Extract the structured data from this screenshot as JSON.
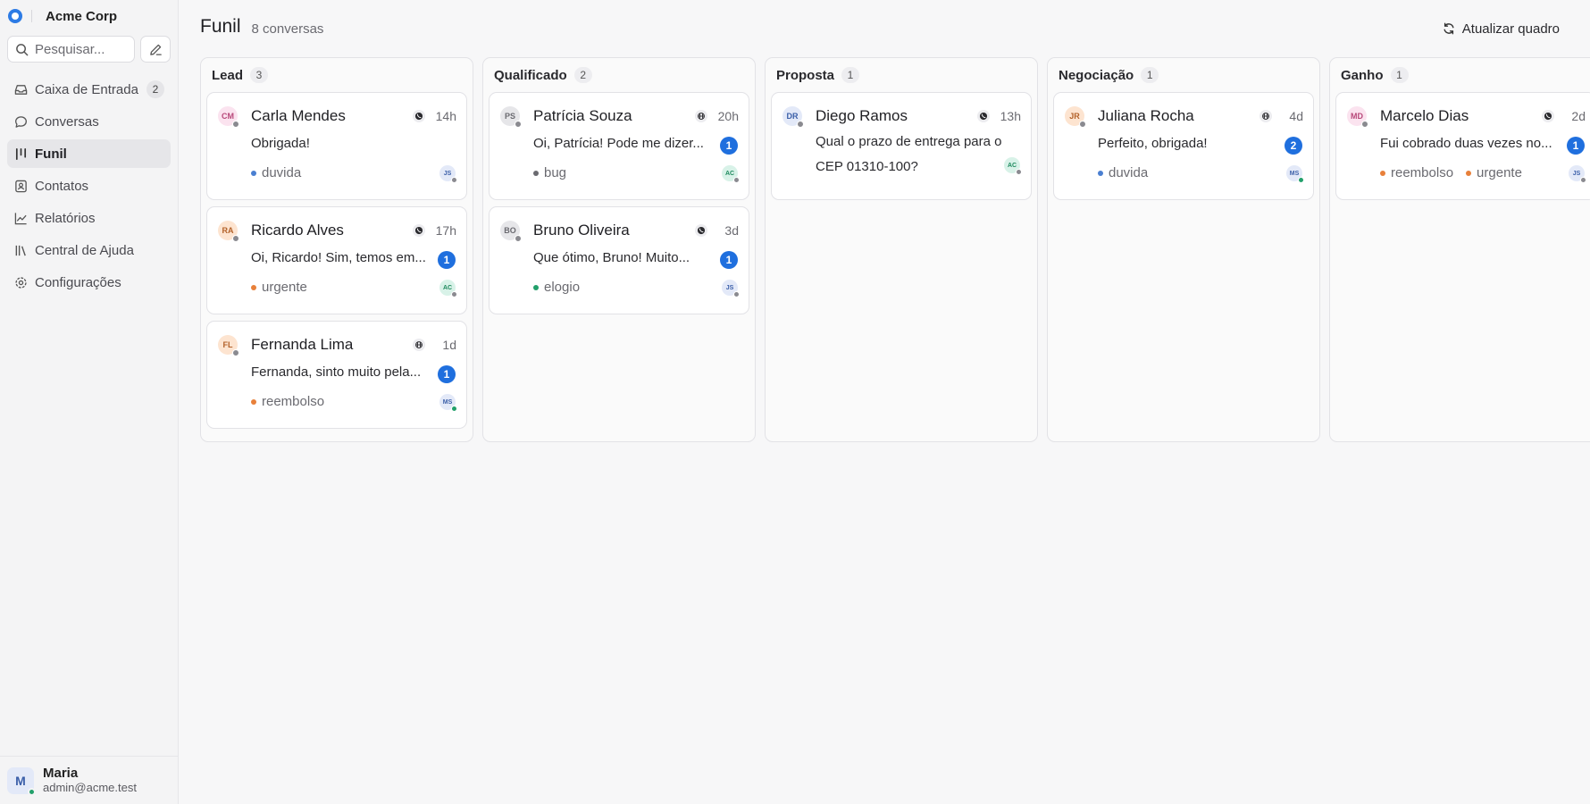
{
  "workspace": {
    "name": "Acme Corp"
  },
  "search": {
    "placeholder": "Pesquisar..."
  },
  "nav": [
    {
      "label": "Caixa de Entrada",
      "icon": "inbox-icon",
      "badge": "2"
    },
    {
      "label": "Conversas",
      "icon": "chat-bubble-icon",
      "badge": ""
    },
    {
      "label": "Funil",
      "icon": "kanban-icon",
      "badge": "",
      "active": true
    },
    {
      "label": "Contatos",
      "icon": "contact-card-icon",
      "badge": ""
    },
    {
      "label": "Relatórios",
      "icon": "line-chart-icon",
      "badge": ""
    },
    {
      "label": "Central de Ajuda",
      "icon": "library-icon",
      "badge": ""
    },
    {
      "label": "Configurações",
      "icon": "gear-icon",
      "badge": ""
    }
  ],
  "user": {
    "initial": "M",
    "name": "Maria",
    "email": "admin@acme.test"
  },
  "header": {
    "title": "Funil",
    "subtitle": "8 conversas",
    "refresh_label": "Atualizar quadro"
  },
  "colors": {
    "accent": "#1f6fde",
    "online": "#22a06b",
    "offline": "#8a8a90"
  },
  "columns": [
    {
      "name": "Lead",
      "count": "3",
      "cards": [
        {
          "initials": "CM",
          "avatar_bg": "#fbe3ef",
          "avatar_fg": "#b8497a",
          "status": "offline",
          "name": "Carla Mendes",
          "channel": "whatsapp-icon",
          "time": "14h",
          "message": "Obrigada!",
          "unread": "",
          "tags": [
            {
              "label": "duvida",
              "color": "#4a7fd1"
            }
          ],
          "agent": "JS",
          "agent_bg": "#e3e9f8",
          "agent_fg": "#3a5ea8",
          "agent_status": "offline"
        },
        {
          "initials": "RA",
          "avatar_bg": "#fde4d0",
          "avatar_fg": "#b3622a",
          "status": "offline",
          "name": "Ricardo Alves",
          "channel": "whatsapp-icon",
          "time": "17h",
          "message": "Oi, Ricardo! Sim, temos em...",
          "unread": "1",
          "tags": [
            {
              "label": "urgente",
              "color": "#e8803a"
            }
          ],
          "agent": "AC",
          "agent_bg": "#d8f2e8",
          "agent_fg": "#1f8a5e",
          "agent_status": "offline"
        },
        {
          "initials": "FL",
          "avatar_bg": "#fde4d0",
          "avatar_fg": "#b3622a",
          "status": "offline",
          "name": "Fernanda Lima",
          "channel": "api-icon",
          "time": "1d",
          "message": "Fernanda, sinto muito pela...",
          "unread": "1",
          "tags": [
            {
              "label": "reembolso",
              "color": "#e8803a"
            }
          ],
          "agent": "MS",
          "agent_bg": "#e3e9f8",
          "agent_fg": "#3a5ea8",
          "agent_status": "online"
        }
      ]
    },
    {
      "name": "Qualificado",
      "count": "2",
      "cards": [
        {
          "initials": "PS",
          "avatar_bg": "#e6e6e9",
          "avatar_fg": "#6a6a70",
          "status": "offline",
          "name": "Patrícia Souza",
          "channel": "api-icon",
          "time": "20h",
          "message": "Oi, Patrícia! Pode me dizer...",
          "unread": "1",
          "tags": [
            {
              "label": "bug",
              "color": "#6a6a70"
            }
          ],
          "agent": "AC",
          "agent_bg": "#d8f2e8",
          "agent_fg": "#1f8a5e",
          "agent_status": "offline"
        },
        {
          "initials": "BO",
          "avatar_bg": "#e6e6e9",
          "avatar_fg": "#6a6a70",
          "status": "offline",
          "name": "Bruno Oliveira",
          "channel": "whatsapp-icon",
          "time": "3d",
          "message": "Que ótimo, Bruno! Muito...",
          "unread": "1",
          "tags": [
            {
              "label": "elogio",
              "color": "#22a06b"
            }
          ],
          "agent": "JS",
          "agent_bg": "#e3e9f8",
          "agent_fg": "#3a5ea8",
          "agent_status": "offline"
        }
      ]
    },
    {
      "name": "Proposta",
      "count": "1",
      "cards": [
        {
          "initials": "DR",
          "avatar_bg": "#e3e9f8",
          "avatar_fg": "#3a5ea8",
          "status": "offline",
          "name": "Diego Ramos",
          "channel": "whatsapp-icon",
          "time": "13h",
          "message": "Qual o prazo de entrega para o CEP 01310-100?",
          "wrap": true,
          "unread": "",
          "tags": [],
          "agent": "AC",
          "agent_bg": "#d8f2e8",
          "agent_fg": "#1f8a5e",
          "agent_status": "offline"
        }
      ]
    },
    {
      "name": "Negociação",
      "count": "1",
      "cards": [
        {
          "initials": "JR",
          "avatar_bg": "#fde4d0",
          "avatar_fg": "#b3622a",
          "status": "offline",
          "name": "Juliana Rocha",
          "channel": "api-icon",
          "time": "4d",
          "message": "Perfeito, obrigada!",
          "unread": "2",
          "tags": [
            {
              "label": "duvida",
              "color": "#4a7fd1"
            }
          ],
          "agent": "MS",
          "agent_bg": "#e3e9f8",
          "agent_fg": "#3a5ea8",
          "agent_status": "online"
        }
      ]
    },
    {
      "name": "Ganho",
      "count": "1",
      "cards": [
        {
          "initials": "MD",
          "avatar_bg": "#fbe3ef",
          "avatar_fg": "#b8497a",
          "status": "offline",
          "name": "Marcelo Dias",
          "channel": "whatsapp-icon",
          "time": "2d",
          "message": "Fui cobrado duas vezes no...",
          "unread": "1",
          "tags": [
            {
              "label": "reembolso",
              "color": "#e8803a"
            },
            {
              "label": "urgente",
              "color": "#e8803a"
            }
          ],
          "agent": "JS",
          "agent_bg": "#e3e9f8",
          "agent_fg": "#3a5ea8",
          "agent_status": "offline"
        }
      ]
    }
  ]
}
